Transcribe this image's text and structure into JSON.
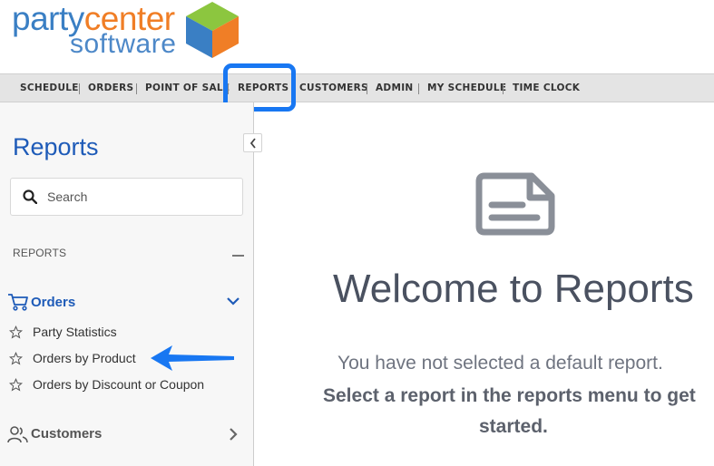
{
  "logo": {
    "party": "party",
    "center": "center",
    "software": "software"
  },
  "nav": {
    "items": [
      "SCHEDULE",
      "ORDERS",
      "POINT OF SALE",
      "REPORTS",
      "CUSTOMERS",
      "ADMIN",
      "MY SCHEDULE",
      "TIME CLOCK"
    ]
  },
  "sidebar": {
    "title": "Reports",
    "search_placeholder": "Search",
    "section_label": "REPORTS",
    "orders": {
      "label": "Orders",
      "items": [
        "Party Statistics",
        "Orders by Product",
        "Orders by Discount or Coupon"
      ]
    },
    "customers_label": "Customers"
  },
  "main": {
    "welcome": "Welcome to Reports",
    "line1": "You have not selected a default report.",
    "line2": "Select a report in the reports menu to get",
    "line3": "started."
  },
  "colors": {
    "accent": "#1e5bb8",
    "highlight": "#1877f2"
  }
}
